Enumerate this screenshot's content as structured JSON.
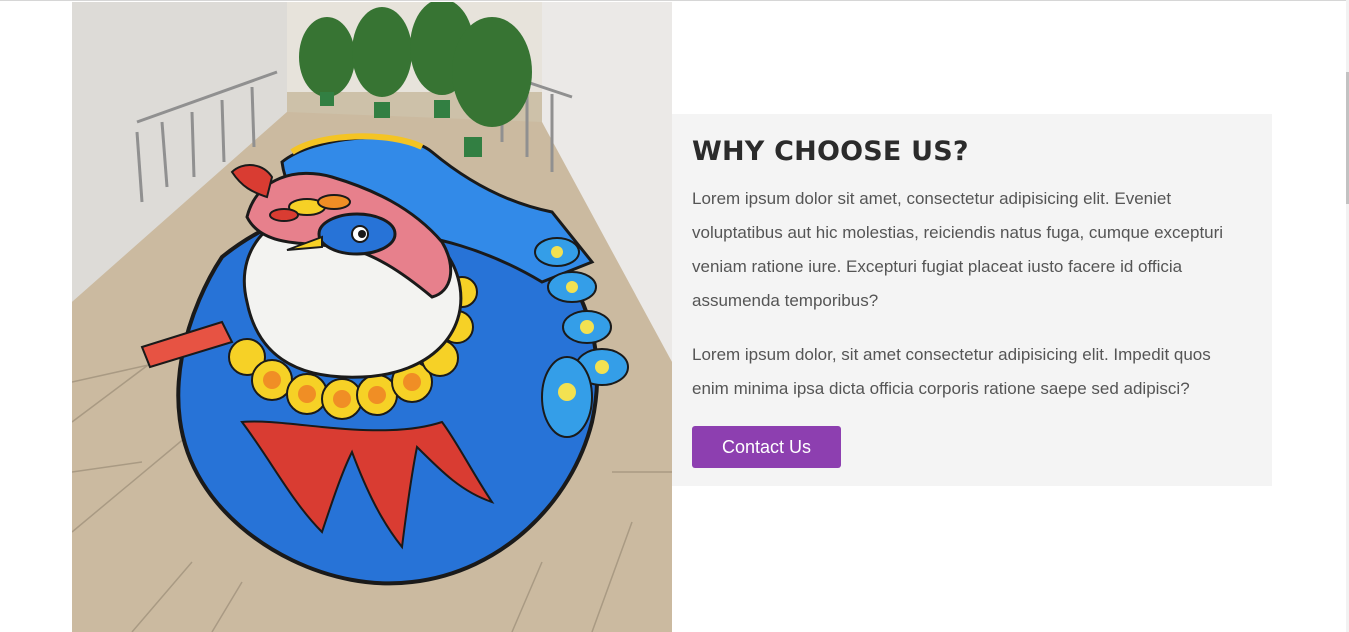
{
  "section": {
    "title": "WHY CHOOSE US?",
    "paragraphs": [
      "Lorem ipsum dolor sit amet, consectetur adipisicing elit. Eveniet voluptatibus aut hic molestias, reiciendis natus fuga, cumque excepturi veniam ratione iure. Excepturi fugiat placeat iusto facere id officia assumenda temporibus?",
      "Lorem ipsum dolor, sit amet consectetur adipisicing elit. Impedit quos enim minima ipsa dicta officia corporis ratione saepe sed adipisci?"
    ],
    "button_label": "Contact Us"
  },
  "colors": {
    "accent": "#8d3fb0",
    "card_bg": "#f4f4f4",
    "heading": "#2b2b2b",
    "body_text": "#555555"
  }
}
